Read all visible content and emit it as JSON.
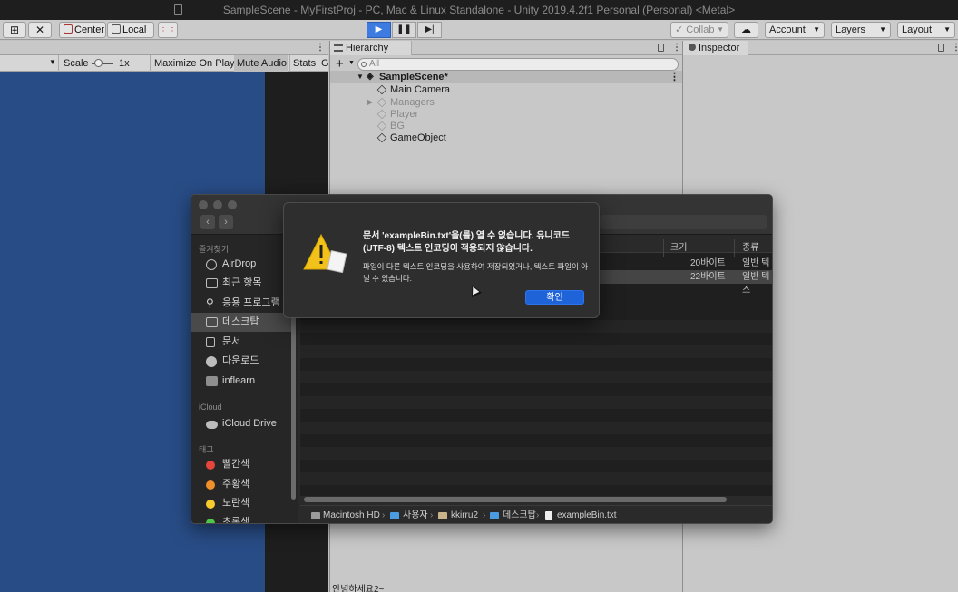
{
  "window": {
    "title": "SampleScene - MyFirstProj - PC, Mac & Linux Standalone - Unity 2019.4.2f1 Personal (Personal) <Metal>"
  },
  "toolbar": {
    "center_label": "Center",
    "local_label": "Local",
    "collab_label": "Collab",
    "account_label": "Account",
    "layers_label": "Layers",
    "layout_label": "Layout"
  },
  "game_view": {
    "scale_label": "Scale",
    "scale_value": "1x",
    "maximize_label": "Maximize On Play",
    "mute_label": "Mute Audio",
    "stats_label": "Stats",
    "gizmos_label": "G"
  },
  "hierarchy": {
    "tab_label": "Hierarchy",
    "search_placeholder": "All",
    "scene_name": "SampleScene*",
    "items": [
      {
        "label": "Main Camera"
      },
      {
        "label": "Managers"
      },
      {
        "label": "Player"
      },
      {
        "label": "BG"
      },
      {
        "label": "GameObject"
      }
    ],
    "console_text": "안녕하세요2~"
  },
  "inspector": {
    "tab_label": "Inspector"
  },
  "finder": {
    "sidebar": {
      "favorites_header": "즐겨찾기",
      "favorites": [
        {
          "label": "AirDrop"
        },
        {
          "label": "최근 항목"
        },
        {
          "label": "응용 프로그램"
        },
        {
          "label": "데스크탑"
        },
        {
          "label": "문서"
        },
        {
          "label": "다운로드"
        },
        {
          "label": "inflearn"
        }
      ],
      "icloud_header": "iCloud",
      "icloud": [
        {
          "label": "iCloud Drive"
        }
      ],
      "tags_header": "태그",
      "tags": [
        {
          "label": "빨간색",
          "color": "#e5453b"
        },
        {
          "label": "주황색",
          "color": "#f0902a"
        },
        {
          "label": "노란색",
          "color": "#f5cc2b"
        },
        {
          "label": "초록색",
          "color": "#4ec64a"
        }
      ]
    },
    "columns": {
      "size": "크기",
      "kind": "종류"
    },
    "files": [
      {
        "size": "20바이트",
        "kind": "일반 텍스"
      },
      {
        "size": "22바이트",
        "kind": "일반 텍스"
      }
    ],
    "path": [
      "Macintosh HD",
      "사용자",
      "kkirru2",
      "데스크탑",
      "exampleBin.txt"
    ]
  },
  "alert": {
    "title": "문서 'exampleBin.txt'을(를) 열 수 없습니다. 유니코드(UTF-8) 텍스트 인코딩이 적용되지 않습니다.",
    "message": "파일이 다른 텍스트 인코딩을 사용하여 저장되었거나, 텍스트 파일이 아닐 수 있습니다.",
    "ok_label": "확인",
    "accent": "#1f63d9"
  }
}
